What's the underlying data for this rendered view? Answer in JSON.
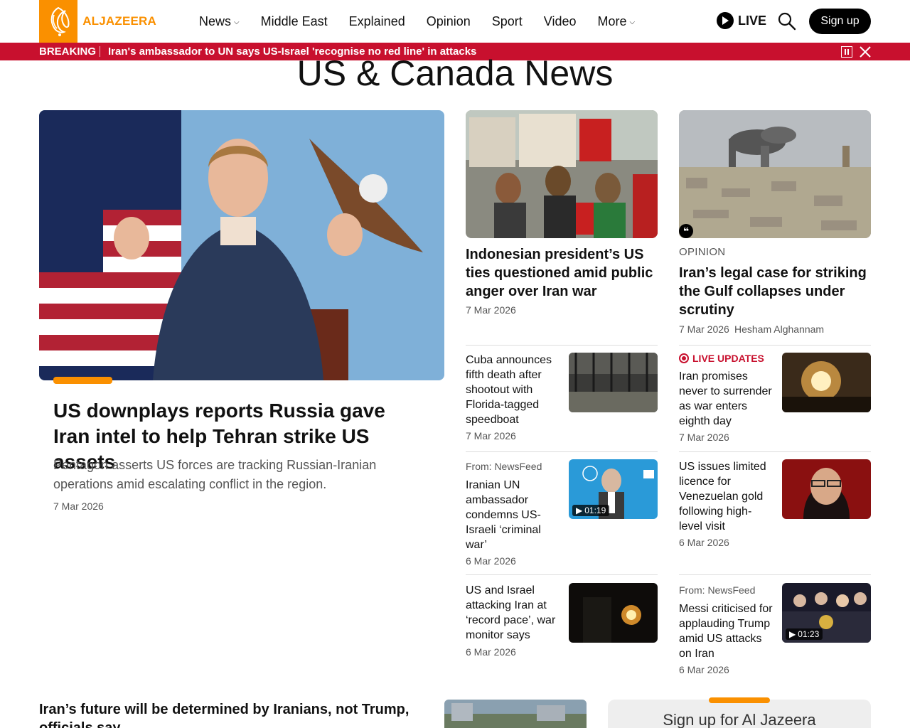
{
  "header": {
    "logo_text": "ALJAZEERA",
    "nav": [
      {
        "label": "News",
        "has_caret": true
      },
      {
        "label": "Middle East",
        "has_caret": false
      },
      {
        "label": "Explained",
        "has_caret": false
      },
      {
        "label": "Opinion",
        "has_caret": false
      },
      {
        "label": "Sport",
        "has_caret": false
      },
      {
        "label": "Video",
        "has_caret": false
      },
      {
        "label": "More",
        "has_caret": true
      }
    ],
    "live_label": "LIVE",
    "signup_label": "Sign up"
  },
  "breaking": {
    "label": "BREAKING",
    "text": "Iran's ambassador to UN says US-Israel 'recognise no red line' in attacks"
  },
  "page_title": "US & Canada News",
  "lead": {
    "title": "US downplays reports Russia gave Iran intel to help Tehran strike US assets",
    "description": "Pentagon asserts US forces are tracking Russian-Iranian operations amid escalating conflict in the region.",
    "date": "7 Mar 2026"
  },
  "card1": {
    "title": "Indonesian president’s US ties questioned amid public anger over Iran war",
    "date": "7 Mar 2026"
  },
  "card2": {
    "label": "OPINION",
    "title": "Iran’s legal case for striking the Gulf collapses under scrutiny",
    "date": "7 Mar 2026",
    "author": "Hesham Alghannam"
  },
  "small_left": [
    {
      "from": "",
      "title": "Cuba announces fifth death after shootout with Florida-tagged speedboat",
      "date": "7 Mar 2026",
      "duration": ""
    },
    {
      "from": "From: NewsFeed",
      "title": "Iranian UN ambassador condemns US-Israeli ‘criminal war’",
      "date": "6 Mar 2026",
      "duration": "01:19"
    },
    {
      "from": "",
      "title": "US and Israel attacking Iran at ‘record pace’, war monitor says",
      "date": "6 Mar 2026",
      "duration": ""
    }
  ],
  "small_right": [
    {
      "live": "LIVE UPDATES",
      "title": "Iran promises never to surrender as war enters eighth day",
      "date": "7 Mar 2026"
    },
    {
      "from": "",
      "title": "US issues limited licence for Venezuelan gold following high-level visit",
      "date": "6 Mar 2026"
    },
    {
      "from": "From: NewsFeed",
      "title": "Messi criticised for applauding Trump amid US attacks on Iran",
      "date": "6 Mar 2026",
      "duration": "01:23"
    }
  ],
  "bottom": {
    "title": "Iran’s future will be determined by Iranians, not Trump, officials say",
    "signup_title": "Sign up for Al Jazeera"
  },
  "colors": {
    "brand": "#fa9000",
    "breaking": "#c8102e"
  }
}
